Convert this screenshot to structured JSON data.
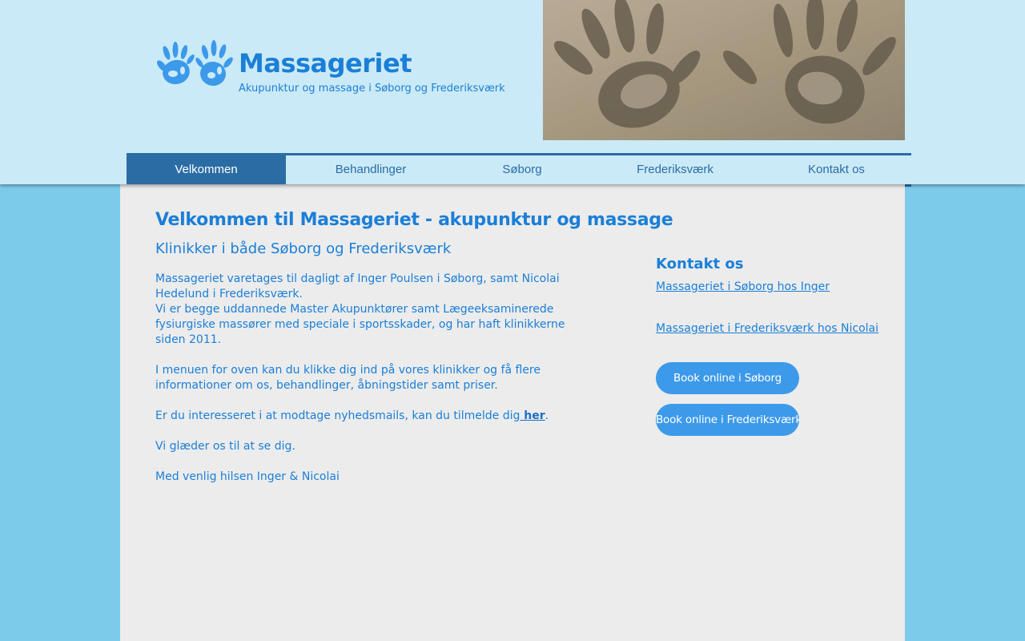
{
  "brand": {
    "title": "Massageriet",
    "subtitle": "Akupunktur og massage i Søborg og Frederiksværk"
  },
  "nav": {
    "items": [
      {
        "label": "Velkommen",
        "active": true
      },
      {
        "label": "Behandlinger"
      },
      {
        "label": "Søborg"
      },
      {
        "label": "Frederiksværk"
      },
      {
        "label": "Kontakt os"
      }
    ]
  },
  "main": {
    "heading": "Velkommen til Massageriet - akupunktur og massage",
    "subheading": "Klinikker i både Søborg og Frederiksværk",
    "p1": "Massageriet varetages til dagligt af Inger Poulsen i Søborg, samt Nicolai Hedelund i Frederiksværk.",
    "p2": "Vi er begge uddannede Master Akupunktører samt Lægeeksaminerede fysiurgiske massører med speciale i sportsskader, og har haft klinikkerne siden 2011.",
    "p3": "I menuen for oven kan du klikke dig ind på vores klinikker og få flere informationer om os, behandlinger, åbningstider samt priser.",
    "p4_before": "Er du interesseret i at modtage nyhedsmails, kan du tilmelde dig",
    "p4_link": " her",
    "p4_after": ".",
    "p5": "Vi glæder os til at se dig.",
    "p6": "Med venlig hilsen Inger & Nicolai"
  },
  "contact": {
    "title": "Kontakt os",
    "link_soborg": "Massageriet i Søborg hos Inger",
    "link_frederiksvaerk": "Massageriet i Frederiksværk hos Nicolai",
    "book_soborg": "Book online i Søborg",
    "book_frederiksvaerk": "Book online i Frederiksværk"
  },
  "colors": {
    "page_bg": "#7dcbea",
    "header_bg": "#cbeaf8",
    "accent": "#1b7fd8",
    "nav_active": "#2b6ca5",
    "button": "#3d9aea"
  },
  "icons": {
    "logo": "handprints-logo-icon",
    "hero": "sand-handprints-photo"
  }
}
